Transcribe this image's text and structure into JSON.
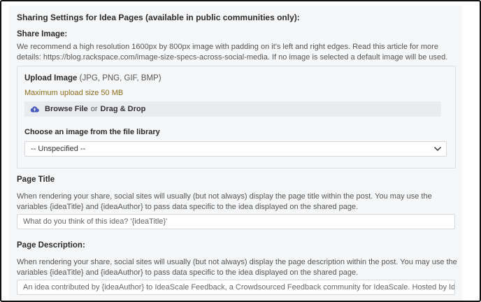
{
  "section_title": "Sharing Settings for Idea Pages (available in public communities only):",
  "share_image": {
    "label": "Share Image:",
    "help": "We recommend a high resolution 1600px by 800px image with padding on it's left and right edges. Read this article for more details: https://blog.rackspace.com/image-size-specs-across-social-media. If no image is selected a default image will be used.",
    "upload_title": "Upload Image",
    "upload_formats": "(JPG, PNG, GIF, BMP)",
    "max_size": "Maximum upload size 50 MB",
    "browse_label": "Browse File",
    "or_label": "or",
    "drag_drop_label": "Drag & Drop",
    "library_label": "Choose an image from the file library",
    "library_selected": "-- Unspecified --"
  },
  "page_title": {
    "label": "Page Title",
    "help": "When rendering your share, social sites will usually (but not always) display the page title within the post. You may use the variables {ideaTitle} and {ideaAuthor} to pass data specific to the idea displayed on the shared page.",
    "value": "What do you think of this idea? '{ideaTitle}'"
  },
  "page_description": {
    "label": "Page Description:",
    "help": "When rendering your share, social sites will usually (but not always) display the page description within the post. You may use the variables {ideaTitle} and {ideaAuthor} to pass data specific to the idea displayed on the shared page.",
    "value": "An idea contributed by {ideaAuthor} to IdeaScale Feedback, a Crowdsourced Feedback community for IdeaScale. Hosted by Idea"
  },
  "icons": {
    "upload": "cloud-upload-icon",
    "dropdown": "chevron-down-icon"
  },
  "colors": {
    "panel_bg": "#f6f7f8",
    "max_size_text": "#8a6d1e",
    "upload_icon": "#4a5bbf"
  }
}
